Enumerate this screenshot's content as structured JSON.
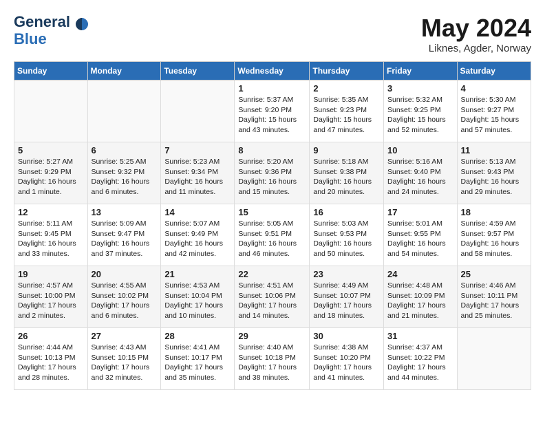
{
  "header": {
    "logo_line1": "General",
    "logo_line2": "Blue",
    "month": "May 2024",
    "location": "Liknes, Agder, Norway"
  },
  "weekdays": [
    "Sunday",
    "Monday",
    "Tuesday",
    "Wednesday",
    "Thursday",
    "Friday",
    "Saturday"
  ],
  "weeks": [
    [
      {
        "day": "",
        "info": ""
      },
      {
        "day": "",
        "info": ""
      },
      {
        "day": "",
        "info": ""
      },
      {
        "day": "1",
        "info": "Sunrise: 5:37 AM\nSunset: 9:20 PM\nDaylight: 15 hours\nand 43 minutes."
      },
      {
        "day": "2",
        "info": "Sunrise: 5:35 AM\nSunset: 9:23 PM\nDaylight: 15 hours\nand 47 minutes."
      },
      {
        "day": "3",
        "info": "Sunrise: 5:32 AM\nSunset: 9:25 PM\nDaylight: 15 hours\nand 52 minutes."
      },
      {
        "day": "4",
        "info": "Sunrise: 5:30 AM\nSunset: 9:27 PM\nDaylight: 15 hours\nand 57 minutes."
      }
    ],
    [
      {
        "day": "5",
        "info": "Sunrise: 5:27 AM\nSunset: 9:29 PM\nDaylight: 16 hours\nand 1 minute."
      },
      {
        "day": "6",
        "info": "Sunrise: 5:25 AM\nSunset: 9:32 PM\nDaylight: 16 hours\nand 6 minutes."
      },
      {
        "day": "7",
        "info": "Sunrise: 5:23 AM\nSunset: 9:34 PM\nDaylight: 16 hours\nand 11 minutes."
      },
      {
        "day": "8",
        "info": "Sunrise: 5:20 AM\nSunset: 9:36 PM\nDaylight: 16 hours\nand 15 minutes."
      },
      {
        "day": "9",
        "info": "Sunrise: 5:18 AM\nSunset: 9:38 PM\nDaylight: 16 hours\nand 20 minutes."
      },
      {
        "day": "10",
        "info": "Sunrise: 5:16 AM\nSunset: 9:40 PM\nDaylight: 16 hours\nand 24 minutes."
      },
      {
        "day": "11",
        "info": "Sunrise: 5:13 AM\nSunset: 9:43 PM\nDaylight: 16 hours\nand 29 minutes."
      }
    ],
    [
      {
        "day": "12",
        "info": "Sunrise: 5:11 AM\nSunset: 9:45 PM\nDaylight: 16 hours\nand 33 minutes."
      },
      {
        "day": "13",
        "info": "Sunrise: 5:09 AM\nSunset: 9:47 PM\nDaylight: 16 hours\nand 37 minutes."
      },
      {
        "day": "14",
        "info": "Sunrise: 5:07 AM\nSunset: 9:49 PM\nDaylight: 16 hours\nand 42 minutes."
      },
      {
        "day": "15",
        "info": "Sunrise: 5:05 AM\nSunset: 9:51 PM\nDaylight: 16 hours\nand 46 minutes."
      },
      {
        "day": "16",
        "info": "Sunrise: 5:03 AM\nSunset: 9:53 PM\nDaylight: 16 hours\nand 50 minutes."
      },
      {
        "day": "17",
        "info": "Sunrise: 5:01 AM\nSunset: 9:55 PM\nDaylight: 16 hours\nand 54 minutes."
      },
      {
        "day": "18",
        "info": "Sunrise: 4:59 AM\nSunset: 9:57 PM\nDaylight: 16 hours\nand 58 minutes."
      }
    ],
    [
      {
        "day": "19",
        "info": "Sunrise: 4:57 AM\nSunset: 10:00 PM\nDaylight: 17 hours\nand 2 minutes."
      },
      {
        "day": "20",
        "info": "Sunrise: 4:55 AM\nSunset: 10:02 PM\nDaylight: 17 hours\nand 6 minutes."
      },
      {
        "day": "21",
        "info": "Sunrise: 4:53 AM\nSunset: 10:04 PM\nDaylight: 17 hours\nand 10 minutes."
      },
      {
        "day": "22",
        "info": "Sunrise: 4:51 AM\nSunset: 10:06 PM\nDaylight: 17 hours\nand 14 minutes."
      },
      {
        "day": "23",
        "info": "Sunrise: 4:49 AM\nSunset: 10:07 PM\nDaylight: 17 hours\nand 18 minutes."
      },
      {
        "day": "24",
        "info": "Sunrise: 4:48 AM\nSunset: 10:09 PM\nDaylight: 17 hours\nand 21 minutes."
      },
      {
        "day": "25",
        "info": "Sunrise: 4:46 AM\nSunset: 10:11 PM\nDaylight: 17 hours\nand 25 minutes."
      }
    ],
    [
      {
        "day": "26",
        "info": "Sunrise: 4:44 AM\nSunset: 10:13 PM\nDaylight: 17 hours\nand 28 minutes."
      },
      {
        "day": "27",
        "info": "Sunrise: 4:43 AM\nSunset: 10:15 PM\nDaylight: 17 hours\nand 32 minutes."
      },
      {
        "day": "28",
        "info": "Sunrise: 4:41 AM\nSunset: 10:17 PM\nDaylight: 17 hours\nand 35 minutes."
      },
      {
        "day": "29",
        "info": "Sunrise: 4:40 AM\nSunset: 10:18 PM\nDaylight: 17 hours\nand 38 minutes."
      },
      {
        "day": "30",
        "info": "Sunrise: 4:38 AM\nSunset: 10:20 PM\nDaylight: 17 hours\nand 41 minutes."
      },
      {
        "day": "31",
        "info": "Sunrise: 4:37 AM\nSunset: 10:22 PM\nDaylight: 17 hours\nand 44 minutes."
      },
      {
        "day": "",
        "info": ""
      }
    ]
  ]
}
